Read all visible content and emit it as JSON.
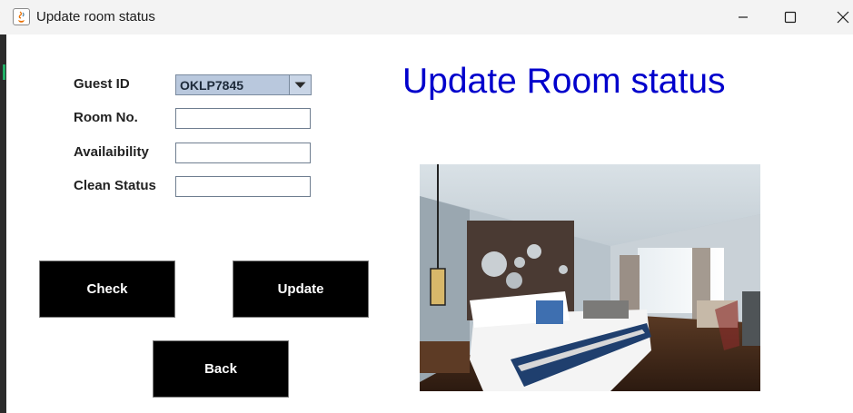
{
  "window": {
    "title": "Update room status"
  },
  "form": {
    "guest_id_label": "Guest ID",
    "guest_id_value": "OKLP7845",
    "room_no_label": "Room No.",
    "room_no_value": "",
    "availability_label": "Availaibility",
    "availability_value": "",
    "clean_status_label": "Clean Status",
    "clean_status_value": ""
  },
  "heading": "Update Room status",
  "buttons": {
    "check": "Check",
    "update": "Update",
    "back": "Back"
  },
  "colors": {
    "heading": "#0000cc",
    "button_bg": "#000000",
    "button_text": "#ffffff",
    "combo_bg": "#b9c8dd"
  },
  "icons": [
    "java-app-icon",
    "minimize-icon",
    "maximize-icon",
    "close-icon",
    "chevron-down-icon"
  ]
}
